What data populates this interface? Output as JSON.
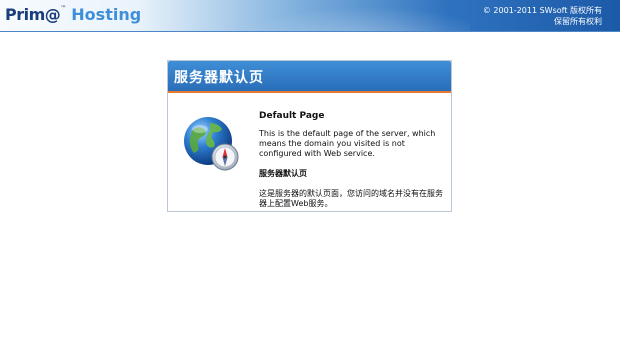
{
  "header": {
    "logo_prima": "Prim@",
    "logo_tm": "™",
    "logo_hosting": "Hosting",
    "copyright_line1": "© 2001-2011 SWsoft 版权所有",
    "copyright_line2": "保留所有权利"
  },
  "panel": {
    "title": "服务器默认页",
    "heading_en": "Default Page",
    "body_en": "This is the default page of the server, which means the domain you visited is not configured with Web service.",
    "heading_zh": "服务器默认页",
    "body_zh": "这是服务器的默认页面，您访问的域名并没有在服务器上配置Web服务。"
  },
  "colors": {
    "header_blue": "#2a6db8",
    "accent_orange": "#e77a2e",
    "logo_dark": "#1a3d7c",
    "logo_light": "#3f8fd8"
  },
  "icons": {
    "globe": "globe-compass-icon"
  }
}
